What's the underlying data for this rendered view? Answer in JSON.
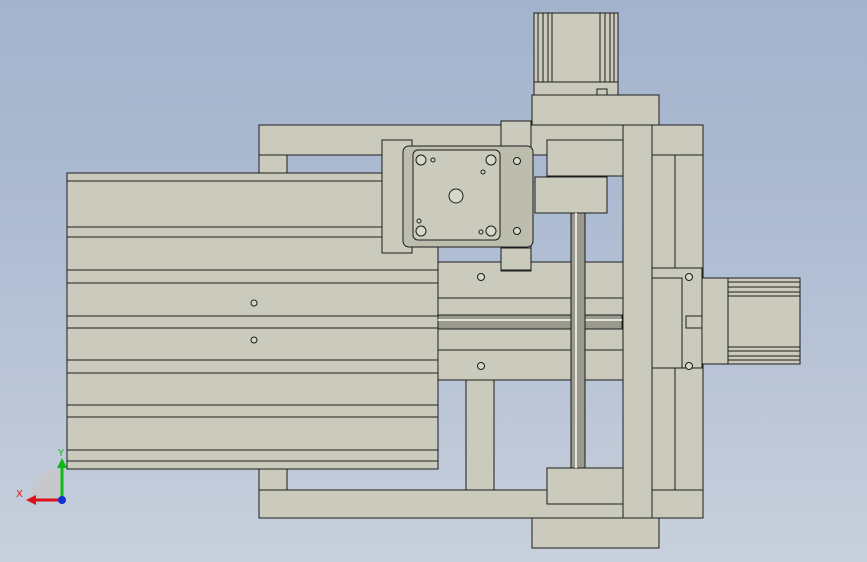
{
  "view": {
    "type": "CAD orthographic top view",
    "background_gradient": [
      "#a3b3cc",
      "#c8d0dc"
    ],
    "part_color": "#cbcbbd",
    "edge_color": "#1c1c1c"
  },
  "triad": {
    "x_label": "X",
    "y_label": "Y",
    "x_color": "#e0101a",
    "y_color": "#12b81a",
    "origin_color": "#1030d0"
  },
  "icons": [
    "stepper-motor-top-icon",
    "stepper-motor-right-icon",
    "ball-screw-icon",
    "linear-rail-icon"
  ]
}
